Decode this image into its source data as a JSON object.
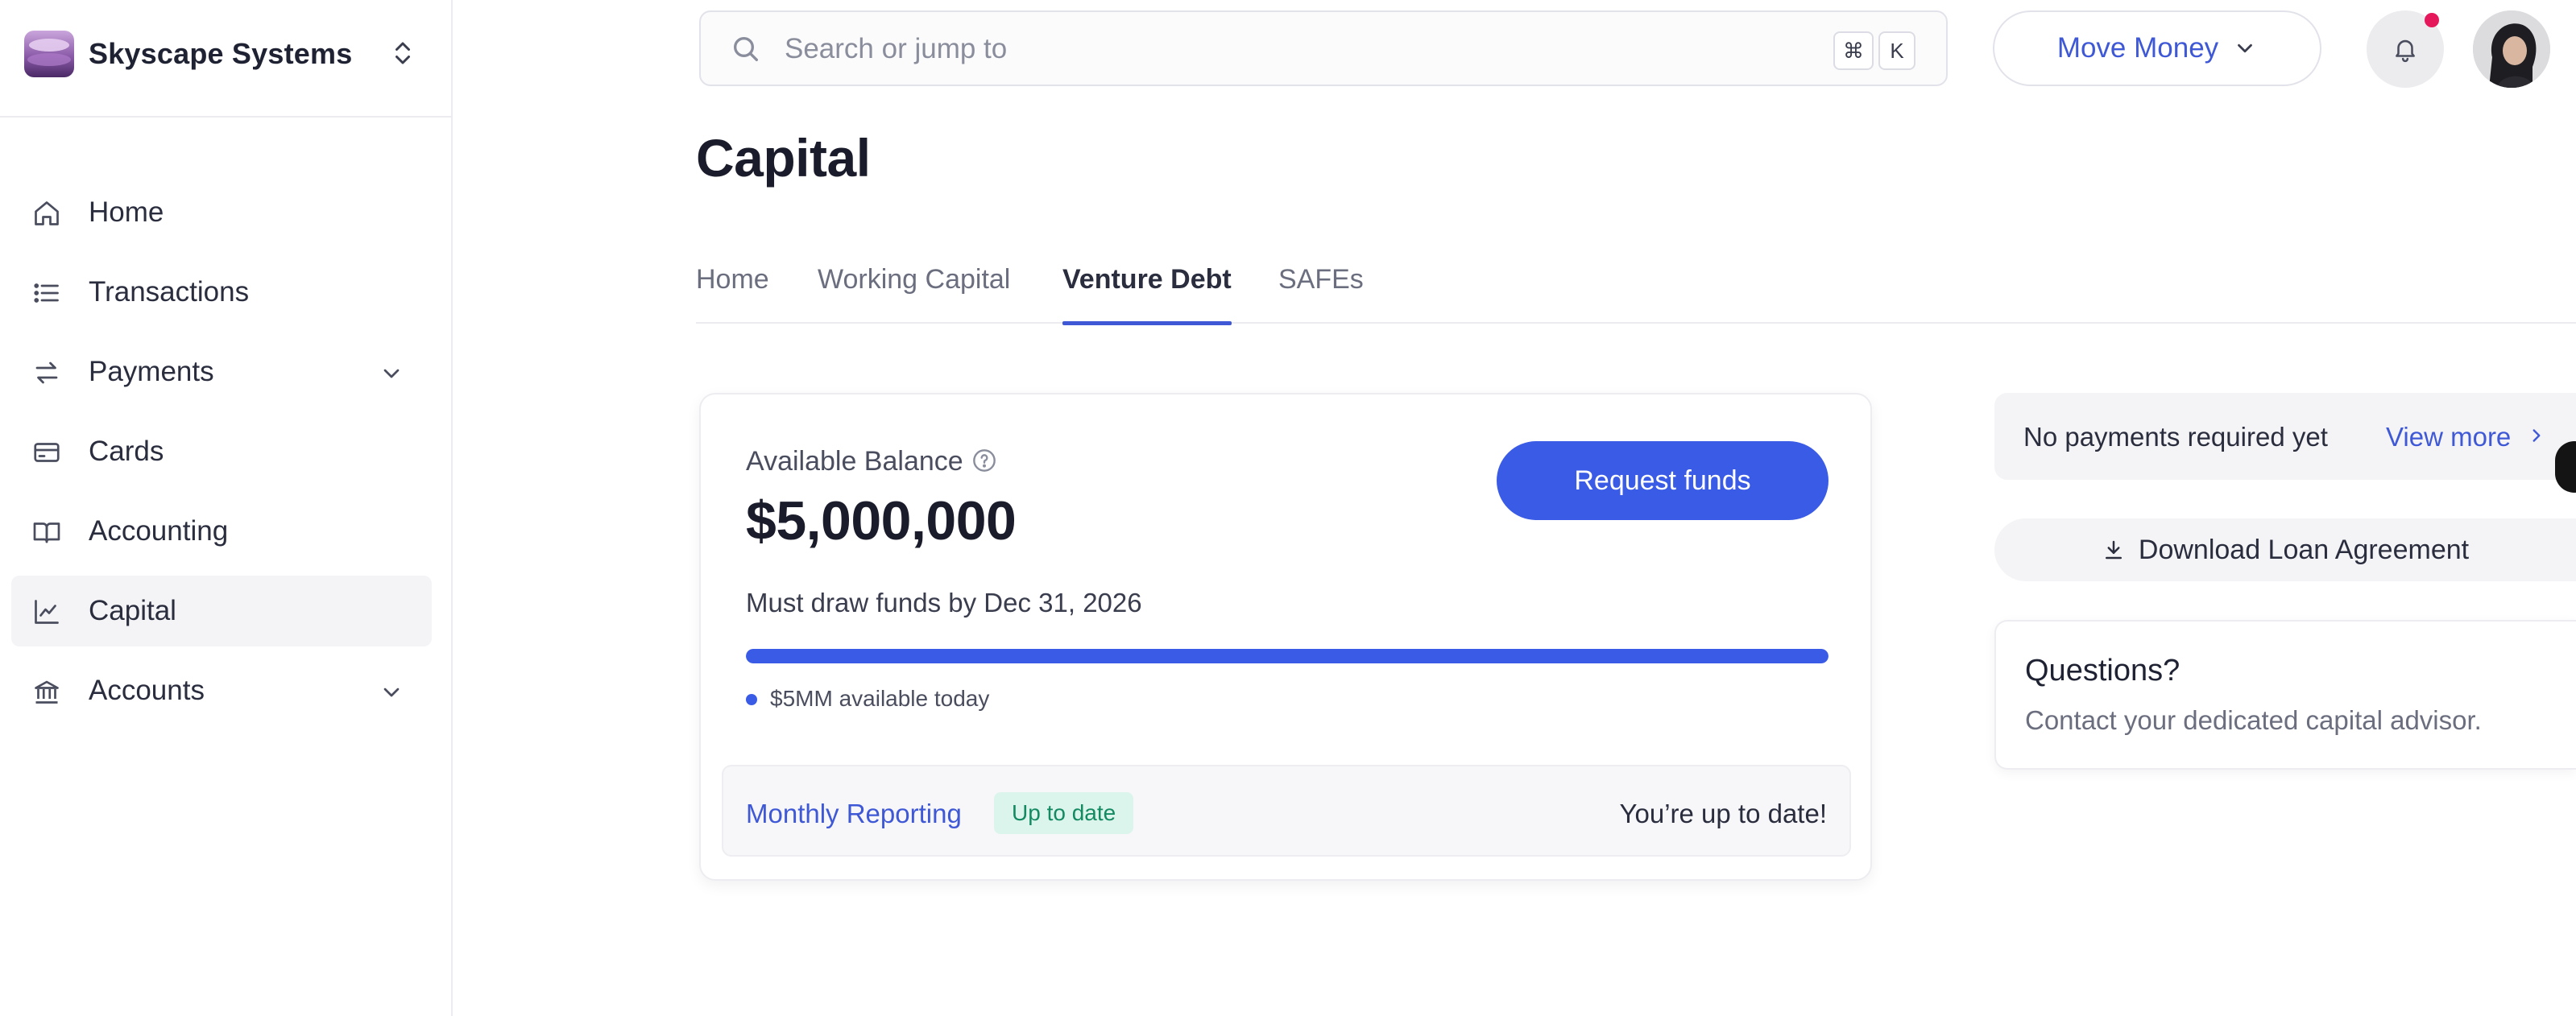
{
  "org": {
    "name": "Skyscape Systems"
  },
  "nav": {
    "items": [
      {
        "label": "Home",
        "icon": "home-icon"
      },
      {
        "label": "Transactions",
        "icon": "list-icon"
      },
      {
        "label": "Payments",
        "icon": "arrows-icon",
        "expandable": true
      },
      {
        "label": "Cards",
        "icon": "card-icon"
      },
      {
        "label": "Accounting",
        "icon": "book-icon"
      },
      {
        "label": "Capital",
        "icon": "chart-line-icon",
        "active": true
      },
      {
        "label": "Accounts",
        "icon": "bank-icon",
        "expandable": true
      }
    ]
  },
  "search": {
    "placeholder": "Search or jump to",
    "shortcut_mod": "⌘",
    "shortcut_key": "K"
  },
  "topbar": {
    "move_money_label": "Move Money",
    "notifications_unread": true
  },
  "page": {
    "title": "Capital",
    "tabs": [
      {
        "label": "Home"
      },
      {
        "label": "Working Capital"
      },
      {
        "label": "Venture Debt",
        "active": true
      },
      {
        "label": "SAFEs"
      }
    ]
  },
  "balance_card": {
    "label": "Available Balance",
    "value": "$5,000,000",
    "request_label": "Request funds",
    "draw_deadline": "Must draw funds by Dec 31, 2026",
    "progress_fraction": 1.0,
    "available_today": "$5MM available today",
    "reporting": {
      "link_label": "Monthly Reporting",
      "badge": "Up to date",
      "status": "You’re up to date!"
    }
  },
  "side_panel": {
    "payments_text": "No payments required yet",
    "view_more_label": "View more",
    "download_label": "Download Loan Agreement",
    "questions_title": "Questions?",
    "questions_body": "Contact your dedicated capital advisor."
  },
  "colors": {
    "accent": "#3a5be6",
    "link": "#3e58d6",
    "badge_bg": "#dcf5ec",
    "badge_text": "#138a62",
    "notification_dot": "#e5185b"
  }
}
